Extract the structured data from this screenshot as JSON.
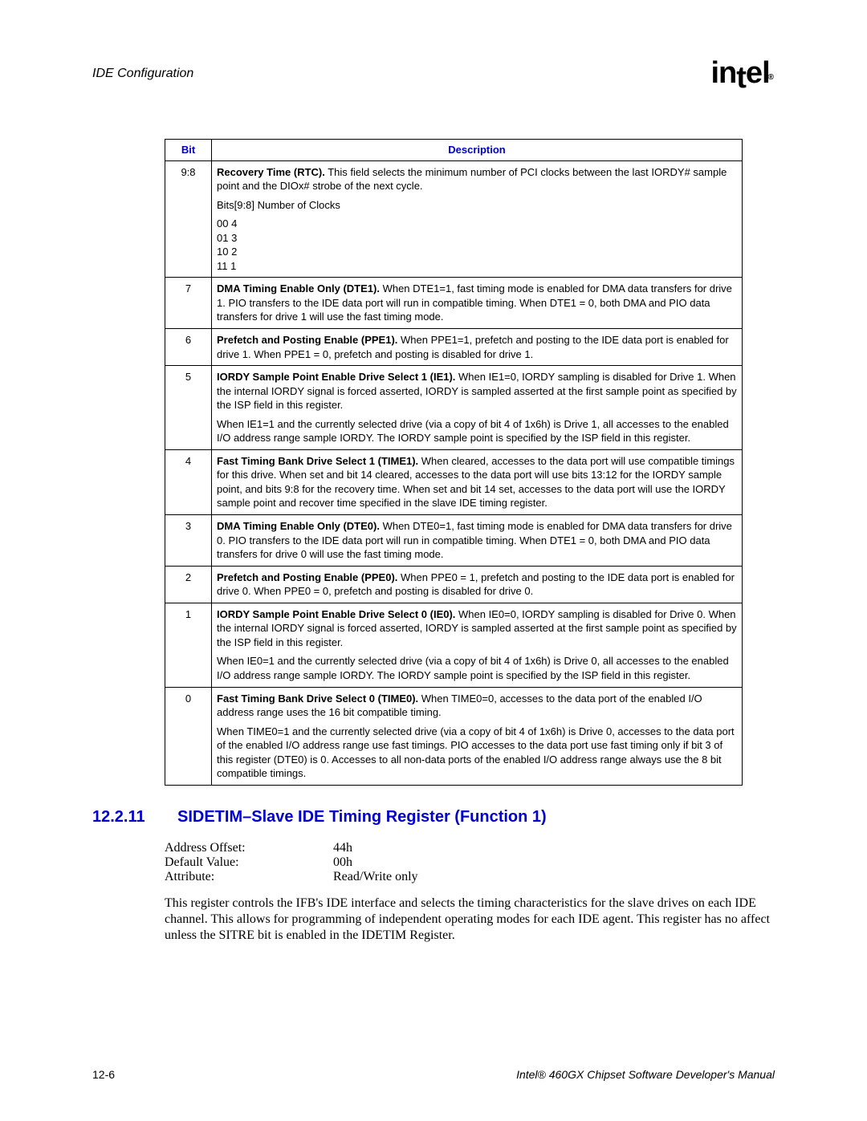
{
  "header": {
    "section": "IDE Configuration",
    "logo_text": "intel",
    "logo_sub": "®"
  },
  "table": {
    "bit_header": "Bit",
    "desc_header": "Description",
    "rows": [
      {
        "bit": "9:8",
        "paras": [
          "<b>Recovery Time (RTC).</b> This field selects the minimum number of PCI clocks between the last IORDY# sample point and the DIOx# strobe of the next cycle.",
          "Bits[9:8] Number of Clocks",
          "00 4<br>01 3<br>10 2<br>11 1"
        ]
      },
      {
        "bit": "7",
        "paras": [
          "<b>DMA Timing Enable Only (DTE1).</b> When DTE1=1, fast timing mode is enabled for DMA data transfers for drive 1. PIO transfers to the IDE data port will run in compatible timing. When DTE1 = 0, both DMA and PIO data transfers for drive 1 will use the fast timing mode."
        ]
      },
      {
        "bit": "6",
        "paras": [
          "<b>Prefetch and Posting Enable (PPE1).</b> When PPE1=1, prefetch and posting to the IDE data port is enabled for drive 1. When PPE1 = 0, prefetch and posting is disabled for drive 1."
        ]
      },
      {
        "bit": "5",
        "paras": [
          "<b>IORDY Sample Point Enable Drive Select 1 (IE1).</b> When IE1=0, IORDY sampling is disabled for Drive 1. When the internal IORDY signal is forced asserted, IORDY is sampled asserted at the first sample point as specified by the ISP field in this register.",
          "When IE1=1 and the currently selected drive (via a copy of bit 4 of 1x6h) is Drive 1, all accesses to the enabled I/O address range sample IORDY. The IORDY sample point is specified by the ISP field in this register."
        ]
      },
      {
        "bit": "4",
        "paras": [
          "<b>Fast Timing Bank Drive Select 1 (TIME1).</b> When cleared, accesses to the data port will use compatible timings for this drive. When set and bit 14 cleared, accesses to the data port will use bits 13:12 for the IORDY sample point, and bits 9:8 for the recovery time. When set and bit 14 set, accesses to the data port will use the IORDY sample point and recover time specified in the slave IDE timing register."
        ]
      },
      {
        "bit": "3",
        "paras": [
          "<b>DMA Timing Enable Only (DTE0).</b> When DTE0=1, fast timing mode is enabled for DMA data transfers for drive 0. PIO transfers to the IDE data port will run in compatible timing. When DTE1 = 0, both DMA and PIO data transfers for drive 0 will use the fast timing mode."
        ]
      },
      {
        "bit": "2",
        "paras": [
          "<b>Prefetch and Posting Enable (PPE0).</b> When PPE0 = 1, prefetch and posting to the IDE data port is enabled for drive 0. When PPE0 = 0, prefetch and posting is disabled for drive 0."
        ]
      },
      {
        "bit": "1",
        "paras": [
          "<b>IORDY Sample Point Enable Drive Select 0 (IE0).</b> When IE0=0, IORDY sampling is disabled for Drive 0. When the internal IORDY signal is forced asserted, IORDY is sampled asserted at the first sample point as specified by the ISP field in this register.",
          "When IE0=1 and the currently selected drive (via a copy of bit 4 of 1x6h) is Drive 0, all accesses to the enabled I/O address range sample IORDY. The IORDY sample point is specified by the ISP field in this register."
        ]
      },
      {
        "bit": "0",
        "paras": [
          "<b>Fast Timing Bank Drive Select 0 (TIME0).</b> When TIME0=0, accesses to the data port of the enabled I/O address range uses the 16 bit compatible timing.",
          "When TIME0=1 and the currently selected drive (via a copy of bit 4 of 1x6h) is Drive 0, accesses to the data port of the enabled I/O address range use fast timings. PIO accesses to the data port use fast timing only if bit 3 of this register (DTE0) is 0. Accesses to all non-data ports of the enabled I/O address range always use the 8 bit compatible timings."
        ]
      }
    ]
  },
  "heading": {
    "number": "12.2.11",
    "title": "SIDETIM–Slave IDE Timing Register (Function 1)"
  },
  "reg": {
    "addr_label": "Address Offset:",
    "addr_val": "44h",
    "default_label": "Default Value:",
    "default_val": "00h",
    "attr_label": "Attribute:",
    "attr_val": "Read/Write only",
    "description": "This register controls the IFB's IDE interface and selects the timing characteristics for the slave drives on each IDE channel. This allows for programming of independent operating modes for each IDE agent. This register has no affect unless the SITRE bit is enabled in the IDETIM Register."
  },
  "footer": {
    "left": "12-6",
    "right": "Intel® 460GX Chipset Software Developer's Manual"
  }
}
